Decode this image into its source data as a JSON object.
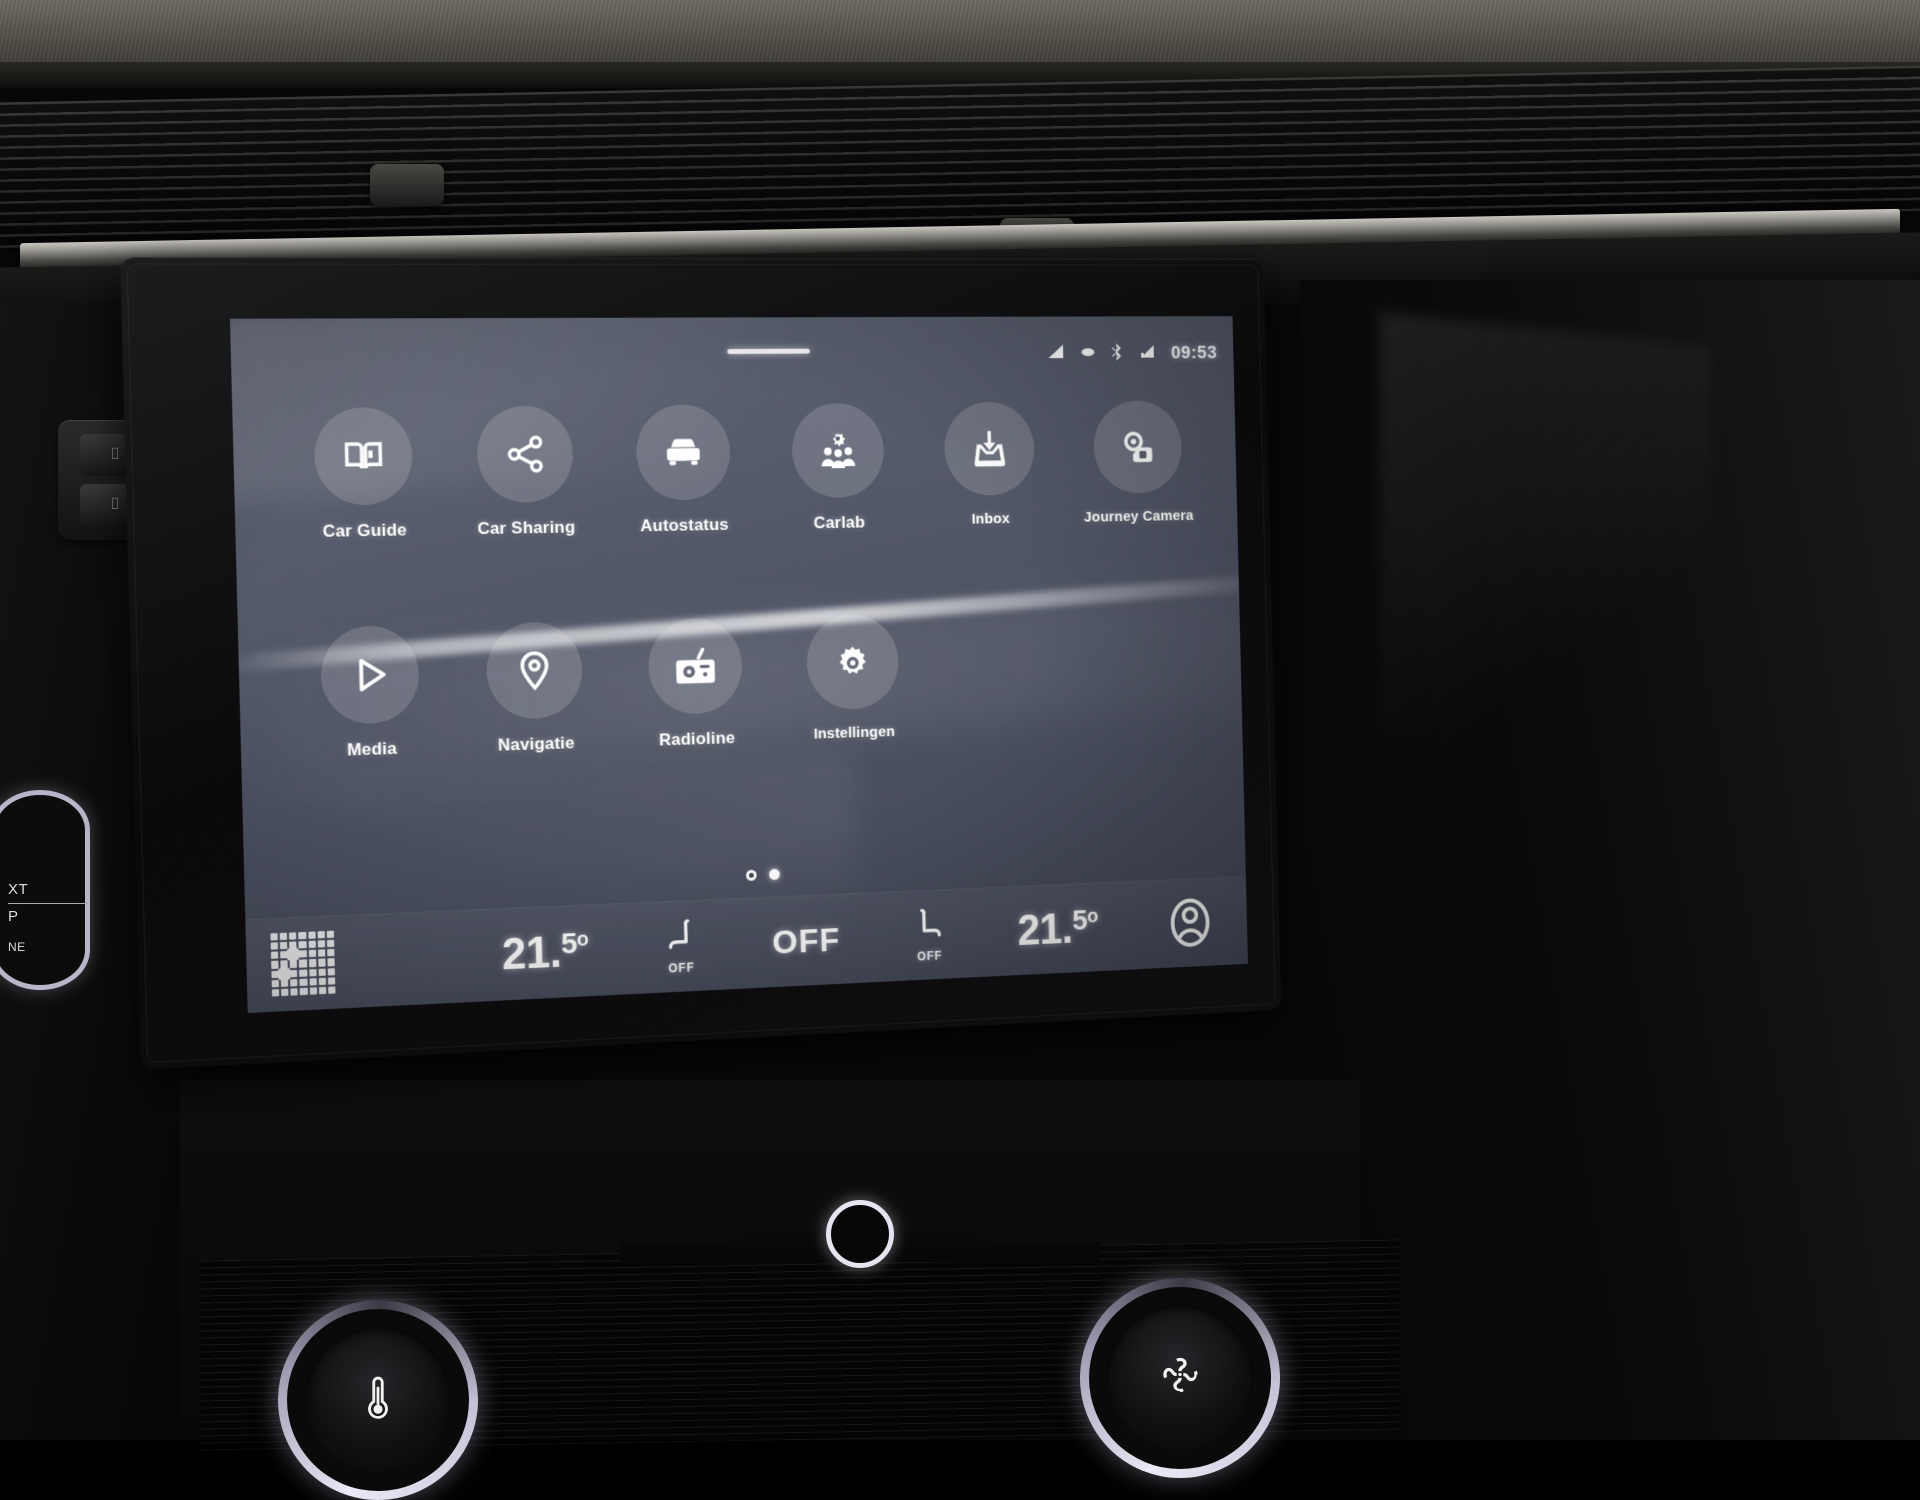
{
  "device": {
    "kind": "car-infotainment-touchscreen",
    "ui_language": "nl-NL"
  },
  "status_bar": {
    "time": "09:53",
    "icons": [
      {
        "name": "cellular-signal-icon",
        "label": "signal"
      },
      {
        "name": "data-indicator-icon",
        "label": "data"
      },
      {
        "name": "bluetooth-icon",
        "label": "bluetooth"
      },
      {
        "name": "wifi-signal-icon",
        "label": "wifi"
      }
    ],
    "pull_handle": "drag-handle"
  },
  "home": {
    "apps_row_1": [
      {
        "label": "Car Guide",
        "icon": "book-icon"
      },
      {
        "label": "Car Sharing",
        "icon": "share-icon"
      },
      {
        "label": "Autostatus",
        "icon": "car-icon"
      },
      {
        "label": "Carlab",
        "icon": "people-group-icon"
      },
      {
        "label": "Inbox",
        "icon": "inbox-download-icon"
      },
      {
        "label": "Journey Camera",
        "icon": "camera-icon"
      }
    ],
    "apps_row_2": [
      {
        "label": "Media",
        "icon": "play-icon"
      },
      {
        "label": "Navigatie",
        "icon": "location-pin-icon"
      },
      {
        "label": "Radioline",
        "icon": "radio-icon"
      },
      {
        "label": "Instellingen",
        "icon": "gear-icon"
      }
    ],
    "page_indicator": {
      "pages": 2,
      "active_page": 2
    }
  },
  "climate_bar": {
    "launcher_icon": "app-grid-icon",
    "driver_temp": "21.",
    "driver_temp_decimal": "5",
    "driver_degree": "o",
    "driver_seat_heater": "OFF",
    "fan_status": "OFF",
    "passenger_seat_heater": "OFF",
    "passenger_temp": "21.",
    "passenger_temp_decimal": "5",
    "passenger_degree": "o",
    "profile_icon": "user-profile-icon"
  },
  "hardware": {
    "center_button": "home-hard-button",
    "left_knob_icon": "thermometer-icon",
    "right_knob_icon": "fan-icon",
    "start_stop_line1": "XT",
    "start_stop_line2": "P",
    "start_stop_line3": "NE"
  },
  "colors": {
    "screen_bg_top": "#5e6373",
    "screen_bg_bottom": "#454a59",
    "icon_circle": "rgba(255,255,255,0.155)",
    "text": "#ffffff",
    "bezel": "#0a0a0b"
  }
}
